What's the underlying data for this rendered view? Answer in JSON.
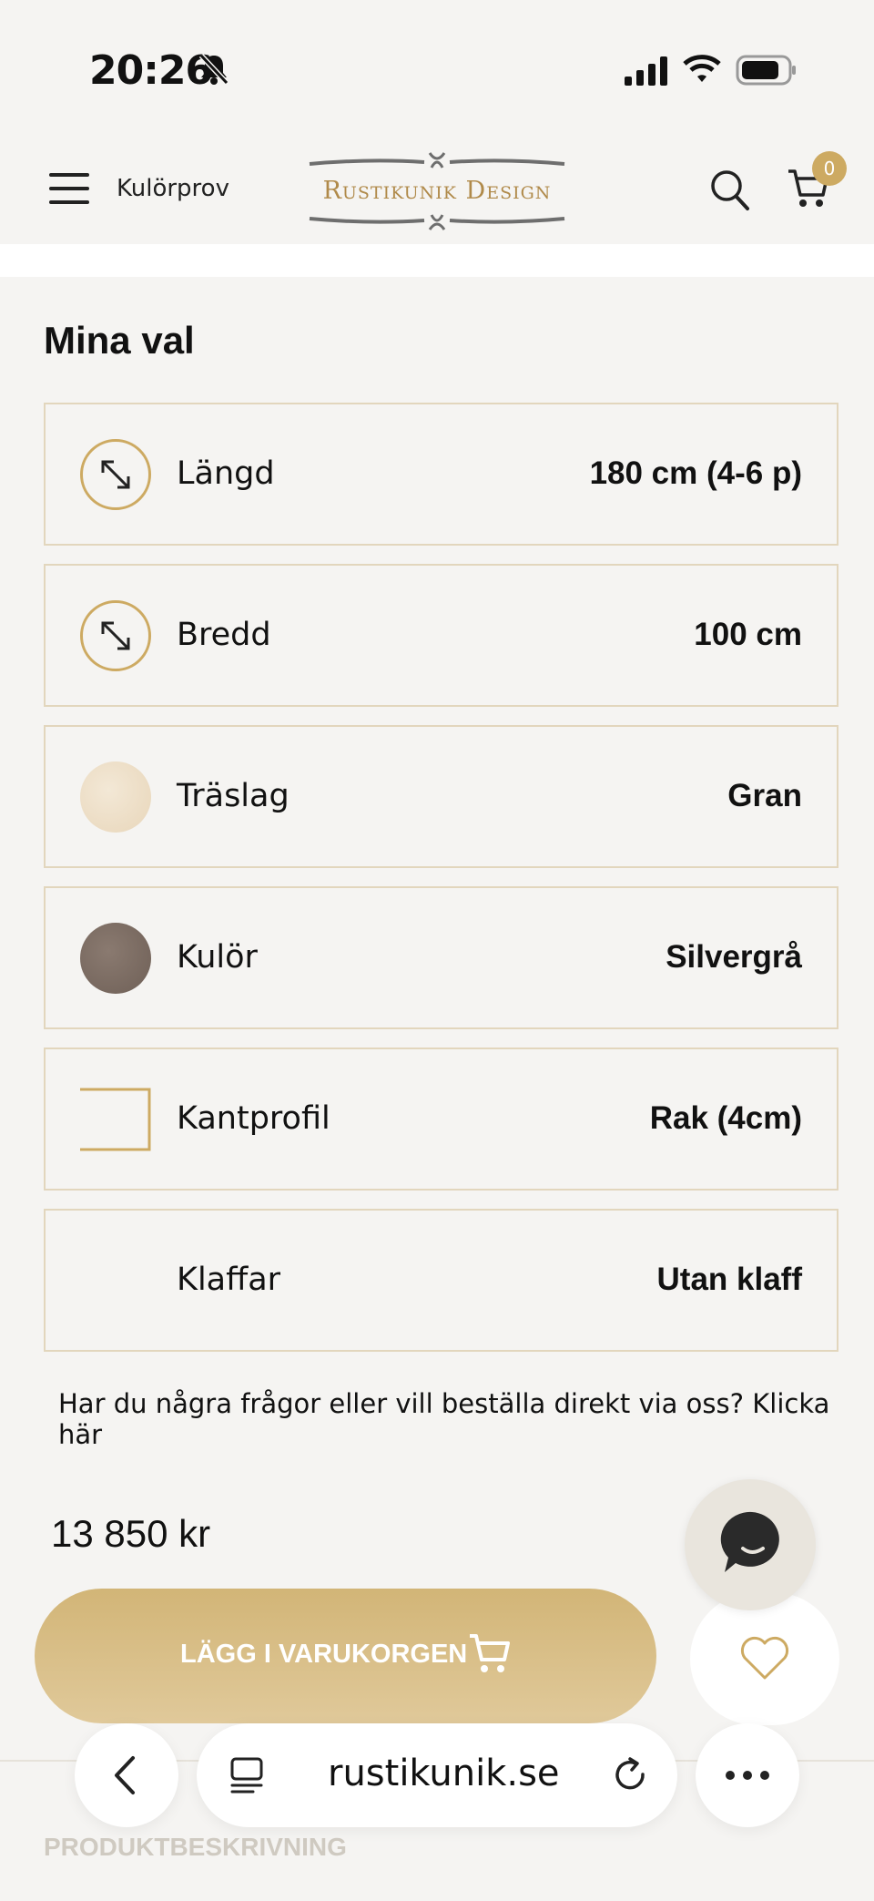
{
  "status_bar": {
    "time": "20:26"
  },
  "header": {
    "menu_label": "Kulörprov",
    "logo_text": "Rustikunik Design",
    "cart_count": "0"
  },
  "section_title": "Mina val",
  "options": [
    {
      "label": "Längd",
      "value": "180 cm (4-6 p)",
      "icon": "resize-arrow-icon"
    },
    {
      "label": "Bredd",
      "value": "100 cm",
      "icon": "resize-arrow-icon"
    },
    {
      "label": "Träslag",
      "value": "Gran",
      "icon": "wood-swatch",
      "swatch_color": "#efe2cc"
    },
    {
      "label": "Kulör",
      "value": "Silvergrå",
      "icon": "color-swatch",
      "swatch_color": "#7c6c62"
    },
    {
      "label": "Kantprofil",
      "value": "Rak (4cm)",
      "icon": "edge-profile-icon"
    },
    {
      "label": "Klaffar",
      "value": "Utan klaff",
      "icon": ""
    }
  ],
  "question_text": "Har du några frågor eller vill beställa direkt via oss? Klicka här",
  "price": "13 850 kr",
  "add_to_cart_label": "LÄGG I VARUKORGEN",
  "description_label": "PRODUKTBESKRIVNING",
  "browser": {
    "url": "rustikunik.se"
  },
  "colors": {
    "accent": "#cdaa62",
    "border": "#e2d6bd",
    "background": "#f5f4f2"
  }
}
